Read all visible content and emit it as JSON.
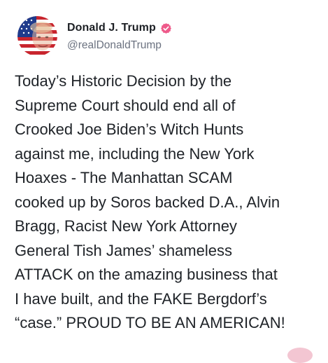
{
  "post": {
    "author": {
      "display_name": "Donald J. Trump",
      "handle": "@realDonaldTrump",
      "verified": true,
      "verified_color": "#ee5a8a",
      "avatar_icon": "flag-portrait-avatar"
    },
    "body_lines": [
      "Today’s Historic Decision by the",
      "Supreme Court should end all of",
      "Crooked Joe Biden’s Witch Hunts",
      "against me, including the New York",
      "Hoaxes - The Manhattan SCAM",
      "cooked up by Soros backed D.A., Alvin",
      "Bragg, Racist New York Attorney",
      "General Tish James’ shameless",
      "ATTACK on the amazing business that",
      "I have built, and the FAKE Bergdorf’s",
      "“case.” PROUD TO BE AN AMERICAN!"
    ]
  }
}
